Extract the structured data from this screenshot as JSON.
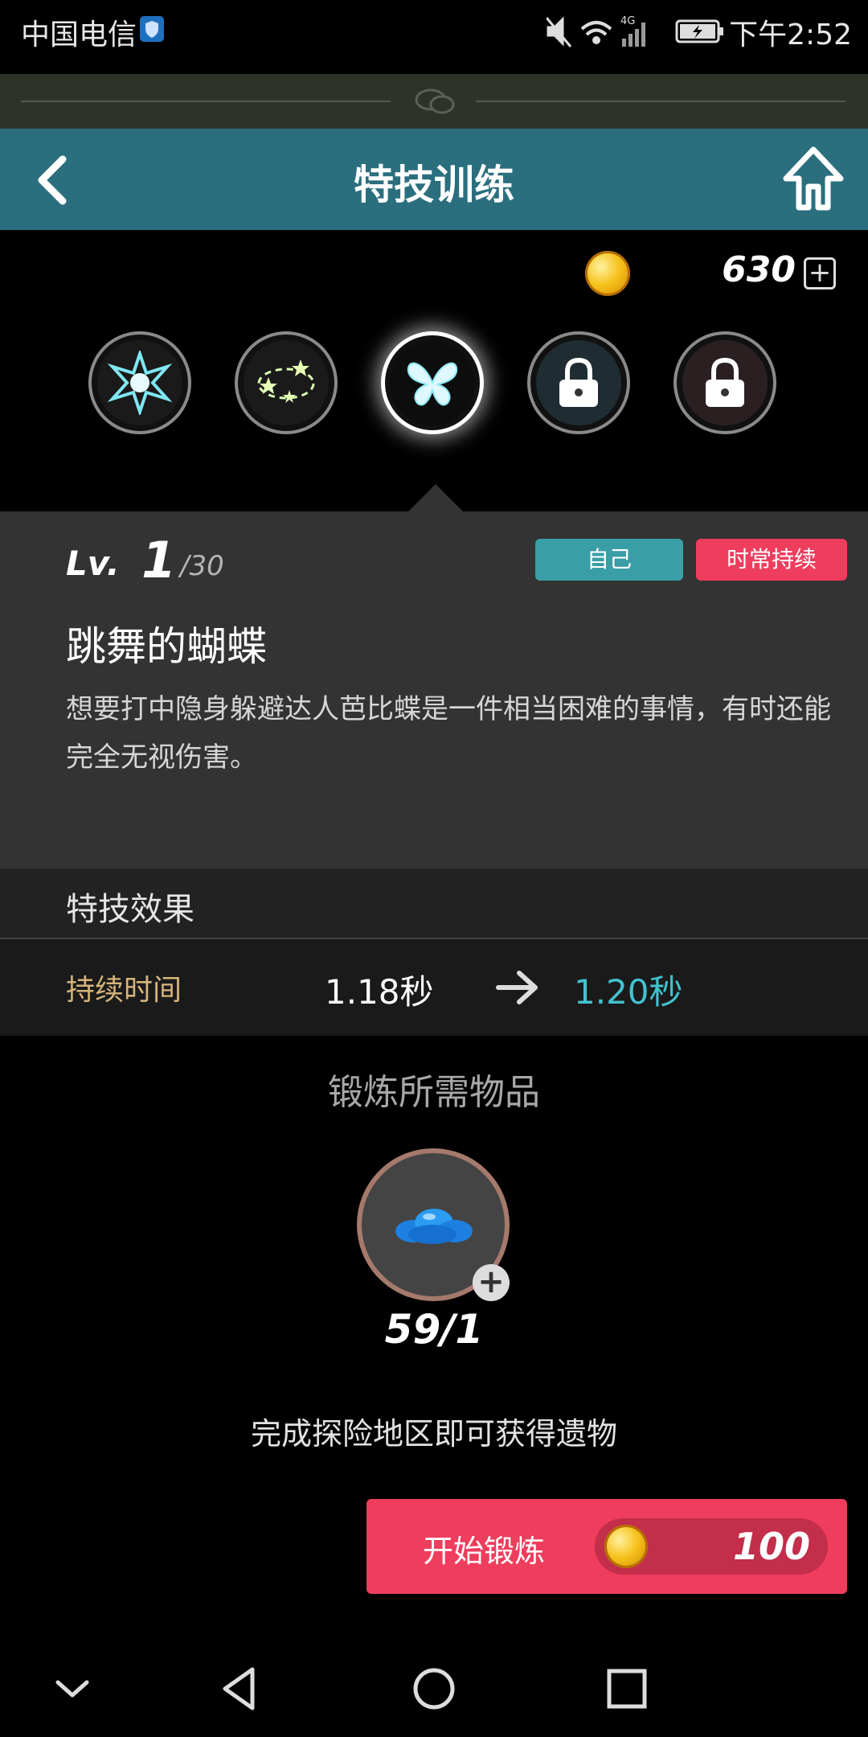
{
  "status_bar": {
    "carrier": "中国电信",
    "time": "下午2:52",
    "network": "4G"
  },
  "header": {
    "title": "特技训练",
    "back_icon": "back-arrow-icon",
    "home_icon": "home-icon"
  },
  "currency": {
    "amount": "630",
    "plus": "+"
  },
  "skills": [
    {
      "name": "skill-burst",
      "icon": "starburst-icon",
      "state": "unlocked"
    },
    {
      "name": "skill-stars",
      "icon": "orbit-stars-icon",
      "state": "unlocked"
    },
    {
      "name": "skill-butterfly",
      "icon": "butterfly-icon",
      "state": "selected"
    },
    {
      "name": "skill-locked-1",
      "icon": "lock-icon",
      "state": "locked"
    },
    {
      "name": "skill-locked-2",
      "icon": "lock-icon",
      "state": "locked"
    }
  ],
  "detail": {
    "level_label": "Lv.",
    "level": "1",
    "level_max": "/30",
    "tag_target": "自己",
    "tag_duration": "时常持续",
    "name": "跳舞的蝴蝶",
    "description": "想要打中隐身躲避达人芭比蝶是一件相当困难的事情，有时还能完全无视伤害。"
  },
  "effect": {
    "title": "特技效果",
    "label": "持续时间",
    "from": "1.18秒",
    "to": "1.20秒"
  },
  "material": {
    "title": "锻炼所需物品",
    "count": "59/1",
    "plus": "+",
    "hint": "完成探险地区即可获得遗物"
  },
  "start": {
    "label": "开始锻炼",
    "cost": "100"
  },
  "colors": {
    "header": "#2b6f7e",
    "accent_teal": "#43c2cf",
    "accent_red": "#ef3d5d",
    "effect_label": "#d7b57a"
  }
}
